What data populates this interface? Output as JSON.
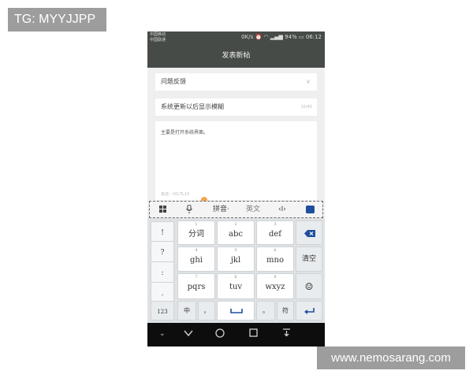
{
  "watermarks": {
    "top_left": "TG: MYYJJPP",
    "bottom_right": "www.nemosarang.com"
  },
  "status": {
    "carrier": "中国移动\n中国联通",
    "speed": "0K/s",
    "battery": "94%",
    "time": "06:12"
  },
  "header": {
    "title": "发表新帖"
  },
  "form": {
    "category": "问题反馈",
    "title": "系统更新以后显示模糊",
    "title_count": "10/40",
    "body": "主要是打开系统界面。",
    "body_meta": "来自：HG-TL10"
  },
  "keyboard": {
    "toolbar": {
      "pinyin": "拼音·",
      "english": "英文",
      "cursor": "‹I›"
    },
    "side_keys": [
      "!",
      "?",
      ":",
      "."
    ],
    "keys": [
      {
        "num": "1",
        "label": "分词"
      },
      {
        "num": "2",
        "label": "abc"
      },
      {
        "num": "3",
        "label": "def"
      },
      {
        "num": "4",
        "label": "ghi"
      },
      {
        "num": "5",
        "label": "jkl"
      },
      {
        "num": "6",
        "label": "mno"
      },
      {
        "num": "7",
        "label": "pqrs"
      },
      {
        "num": "8",
        "label": "tuv"
      },
      {
        "num": "9",
        "label": "wxyz"
      }
    ],
    "clear": "清空",
    "bottom": {
      "num_mode": "123",
      "lang": "中",
      "comma": "，",
      "period": "。",
      "symbols": "符"
    }
  },
  "icons": [
    "grid-icon",
    "microphone-icon",
    "hide-keyboard-icon",
    "backspace-icon",
    "emoji-icon",
    "space-icon",
    "enter-icon",
    "back-icon",
    "home-icon",
    "recent-apps-icon",
    "notification-icon",
    "collapse-icon"
  ],
  "colors": {
    "titlebar": "#474b47",
    "navbar": "#0d0d0d",
    "keyboard_bg": "#dfe2e4",
    "accent": "#1f4e9c"
  }
}
